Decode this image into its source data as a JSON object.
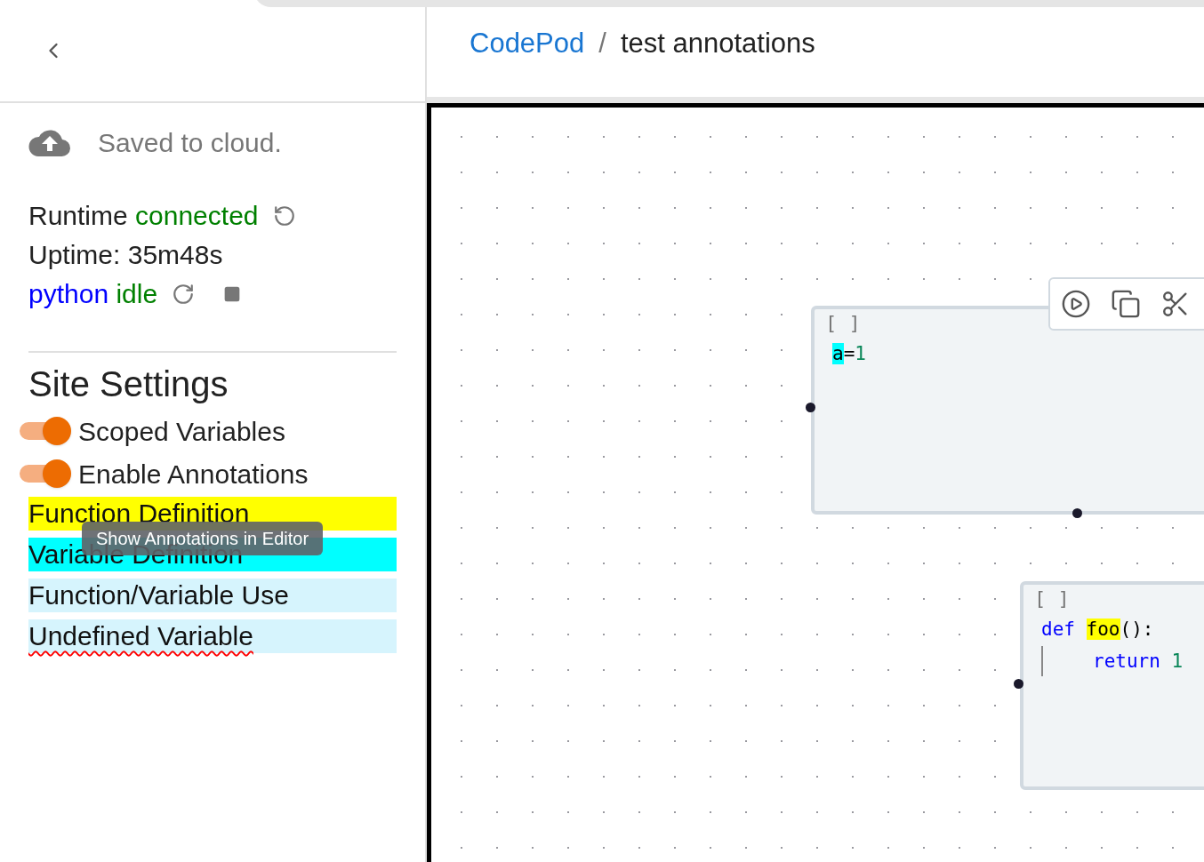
{
  "header": {
    "breadcrumb": [
      {
        "label": "CodePod",
        "kind": "link"
      },
      {
        "label": "test annotations",
        "kind": "current"
      }
    ],
    "separator": "/"
  },
  "sidebar": {
    "save_status": "Saved to cloud.",
    "runtime": {
      "label": "Runtime",
      "status": "connected",
      "uptime": "Uptime: 35m48s",
      "kernel": "python",
      "kernel_status": "idle"
    },
    "settings_title": "Site Settings",
    "toggles": [
      {
        "label": "Scoped Variables",
        "on": true
      },
      {
        "label": "Enable Annotations",
        "on": true
      }
    ],
    "legend": [
      {
        "label": "Function Definition",
        "kind": "function_def"
      },
      {
        "label": "Variable Definition",
        "kind": "variable_def"
      },
      {
        "label": "Function/Variable Use",
        "kind": "use"
      },
      {
        "label": "Undefined Variable",
        "kind": "undefined"
      }
    ],
    "tooltip": "Show Annotations in Editor"
  },
  "canvas": {
    "pods": [
      {
        "prompt": "[ ]",
        "toolbar": true,
        "lines": [
          {
            "indented": false,
            "tokens": [
              {
                "text": "a",
                "kind": "variable_def"
              },
              {
                "text": "=",
                "kind": "plain"
              },
              {
                "text": "1",
                "kind": "number"
              }
            ]
          }
        ]
      },
      {
        "prompt": "[ ]",
        "toolbar": false,
        "lines": [
          {
            "indented": false,
            "tokens": [
              {
                "text": "def ",
                "kind": "keyword"
              },
              {
                "text": "foo",
                "kind": "function_def"
              },
              {
                "text": "():",
                "kind": "plain"
              }
            ]
          },
          {
            "indented": true,
            "tokens": [
              {
                "text": "return ",
                "kind": "keyword"
              },
              {
                "text": "1",
                "kind": "number"
              }
            ]
          }
        ]
      }
    ]
  }
}
